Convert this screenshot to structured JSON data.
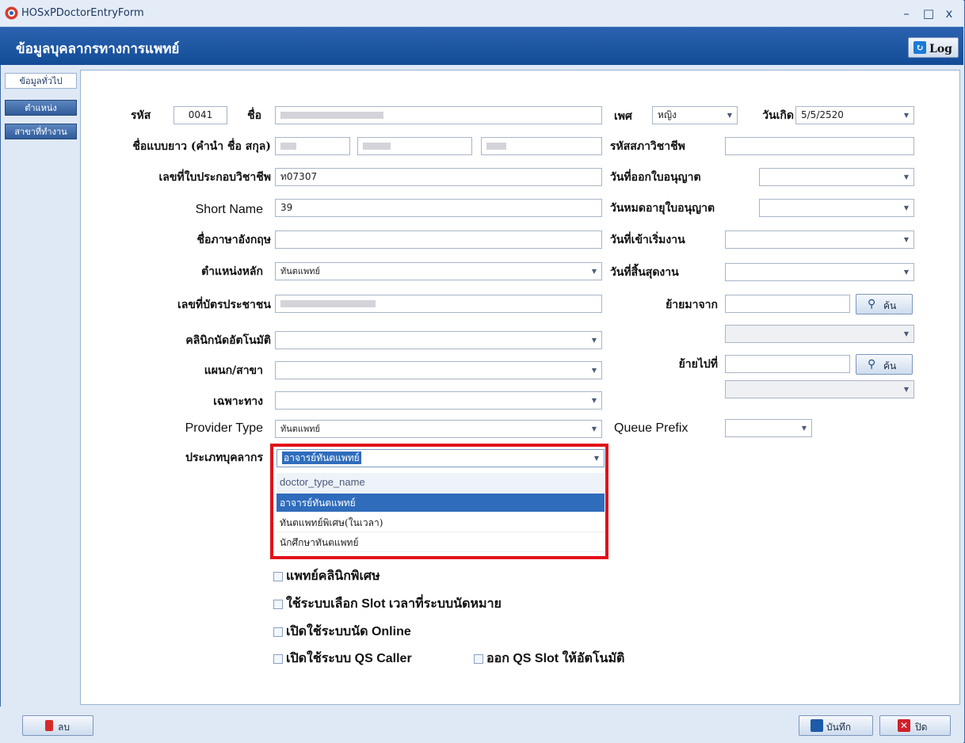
{
  "window": {
    "title": "HOSxPDoctorEntryForm",
    "min": "–",
    "max": "□",
    "close": "x"
  },
  "header": {
    "title": "ข้อมูลบุคลากรทางการแพทย์",
    "log_label": "Log"
  },
  "sidetabs": [
    "ข้อมูลทั่วไป",
    "ตำแหน่ง",
    "สาขาที่ทำงาน"
  ],
  "form": {
    "code_label": "รหัส",
    "code_value": "0041",
    "name_label": "ชื่อ",
    "gender_label": "เพศ",
    "gender_value": "หญิง",
    "birth_label": "วันเกิด",
    "birth_value": "5/5/2520",
    "fullname_label": "ชื่อแบบยาว (คำนำ ชื่อ สกุล)",
    "council_code_label": "รหัสสภาวิชาชีพ",
    "license_label": "เลขที่ใบประกอบวิชาชีพ",
    "license_value": "ท07307",
    "license_issue_label": "วันที่ออกใบอนุญาต",
    "short_name_label": "Short Name",
    "short_name_value": "39",
    "license_expire_label": "วันหมดอายุใบอนุญาต",
    "english_name_label": "ชื่อภาษาอังกฤษ",
    "start_date_label": "วันที่เข้าเริ่มงาน",
    "position_label": "ตำแหน่งหลัก",
    "position_value": "ทันตแพทย์",
    "end_date_label": "วันที่สิ้นสุดงาน",
    "cid_label": "เลขที่บัตรประชาชน",
    "moved_from_label": "ย้ายมาจาก",
    "search_label": "ค้น",
    "auto_clinic_label": "คลินิกนัดอัตโนมัติ",
    "department_label": "แผนก/สาขา",
    "moved_to_label": "ย้ายไปที่",
    "specialty_label": "เฉพาะทาง",
    "provider_type_label": "Provider Type",
    "provider_type_value": "ทันตแพทย์",
    "queue_prefix_label": "Queue Prefix",
    "personnel_type_label": "ประเภทบุคลากร",
    "personnel_type_value": "อาจารย์ทันตแพทย์"
  },
  "dropdown": {
    "header": "doctor_type_name",
    "options": [
      "อาจารย์ทันตแพทย์",
      "ทันตแพทย์พิเศษ(ในเวลา)",
      "นักศึกษาทันตแพทย์"
    ]
  },
  "checkboxes": {
    "special_clinic": "แพทย์คลินิกพิเศษ",
    "slot_system": "ใช้ระบบเลือก Slot เวลาที่ระบบนัดหมาย",
    "online_appt": "เปิดใช้ระบบนัด Online",
    "qs_caller": "เปิดใช้ระบบ QS Caller",
    "qs_slot": "ออก QS Slot ให้อัตโนมัติ"
  },
  "footer": {
    "delete": "ลบ",
    "save": "บันทึก",
    "close": "ปิด"
  },
  "colors": {
    "accent": "#134c96",
    "highlight": "#e1111b",
    "selection": "#2f6cbc"
  }
}
